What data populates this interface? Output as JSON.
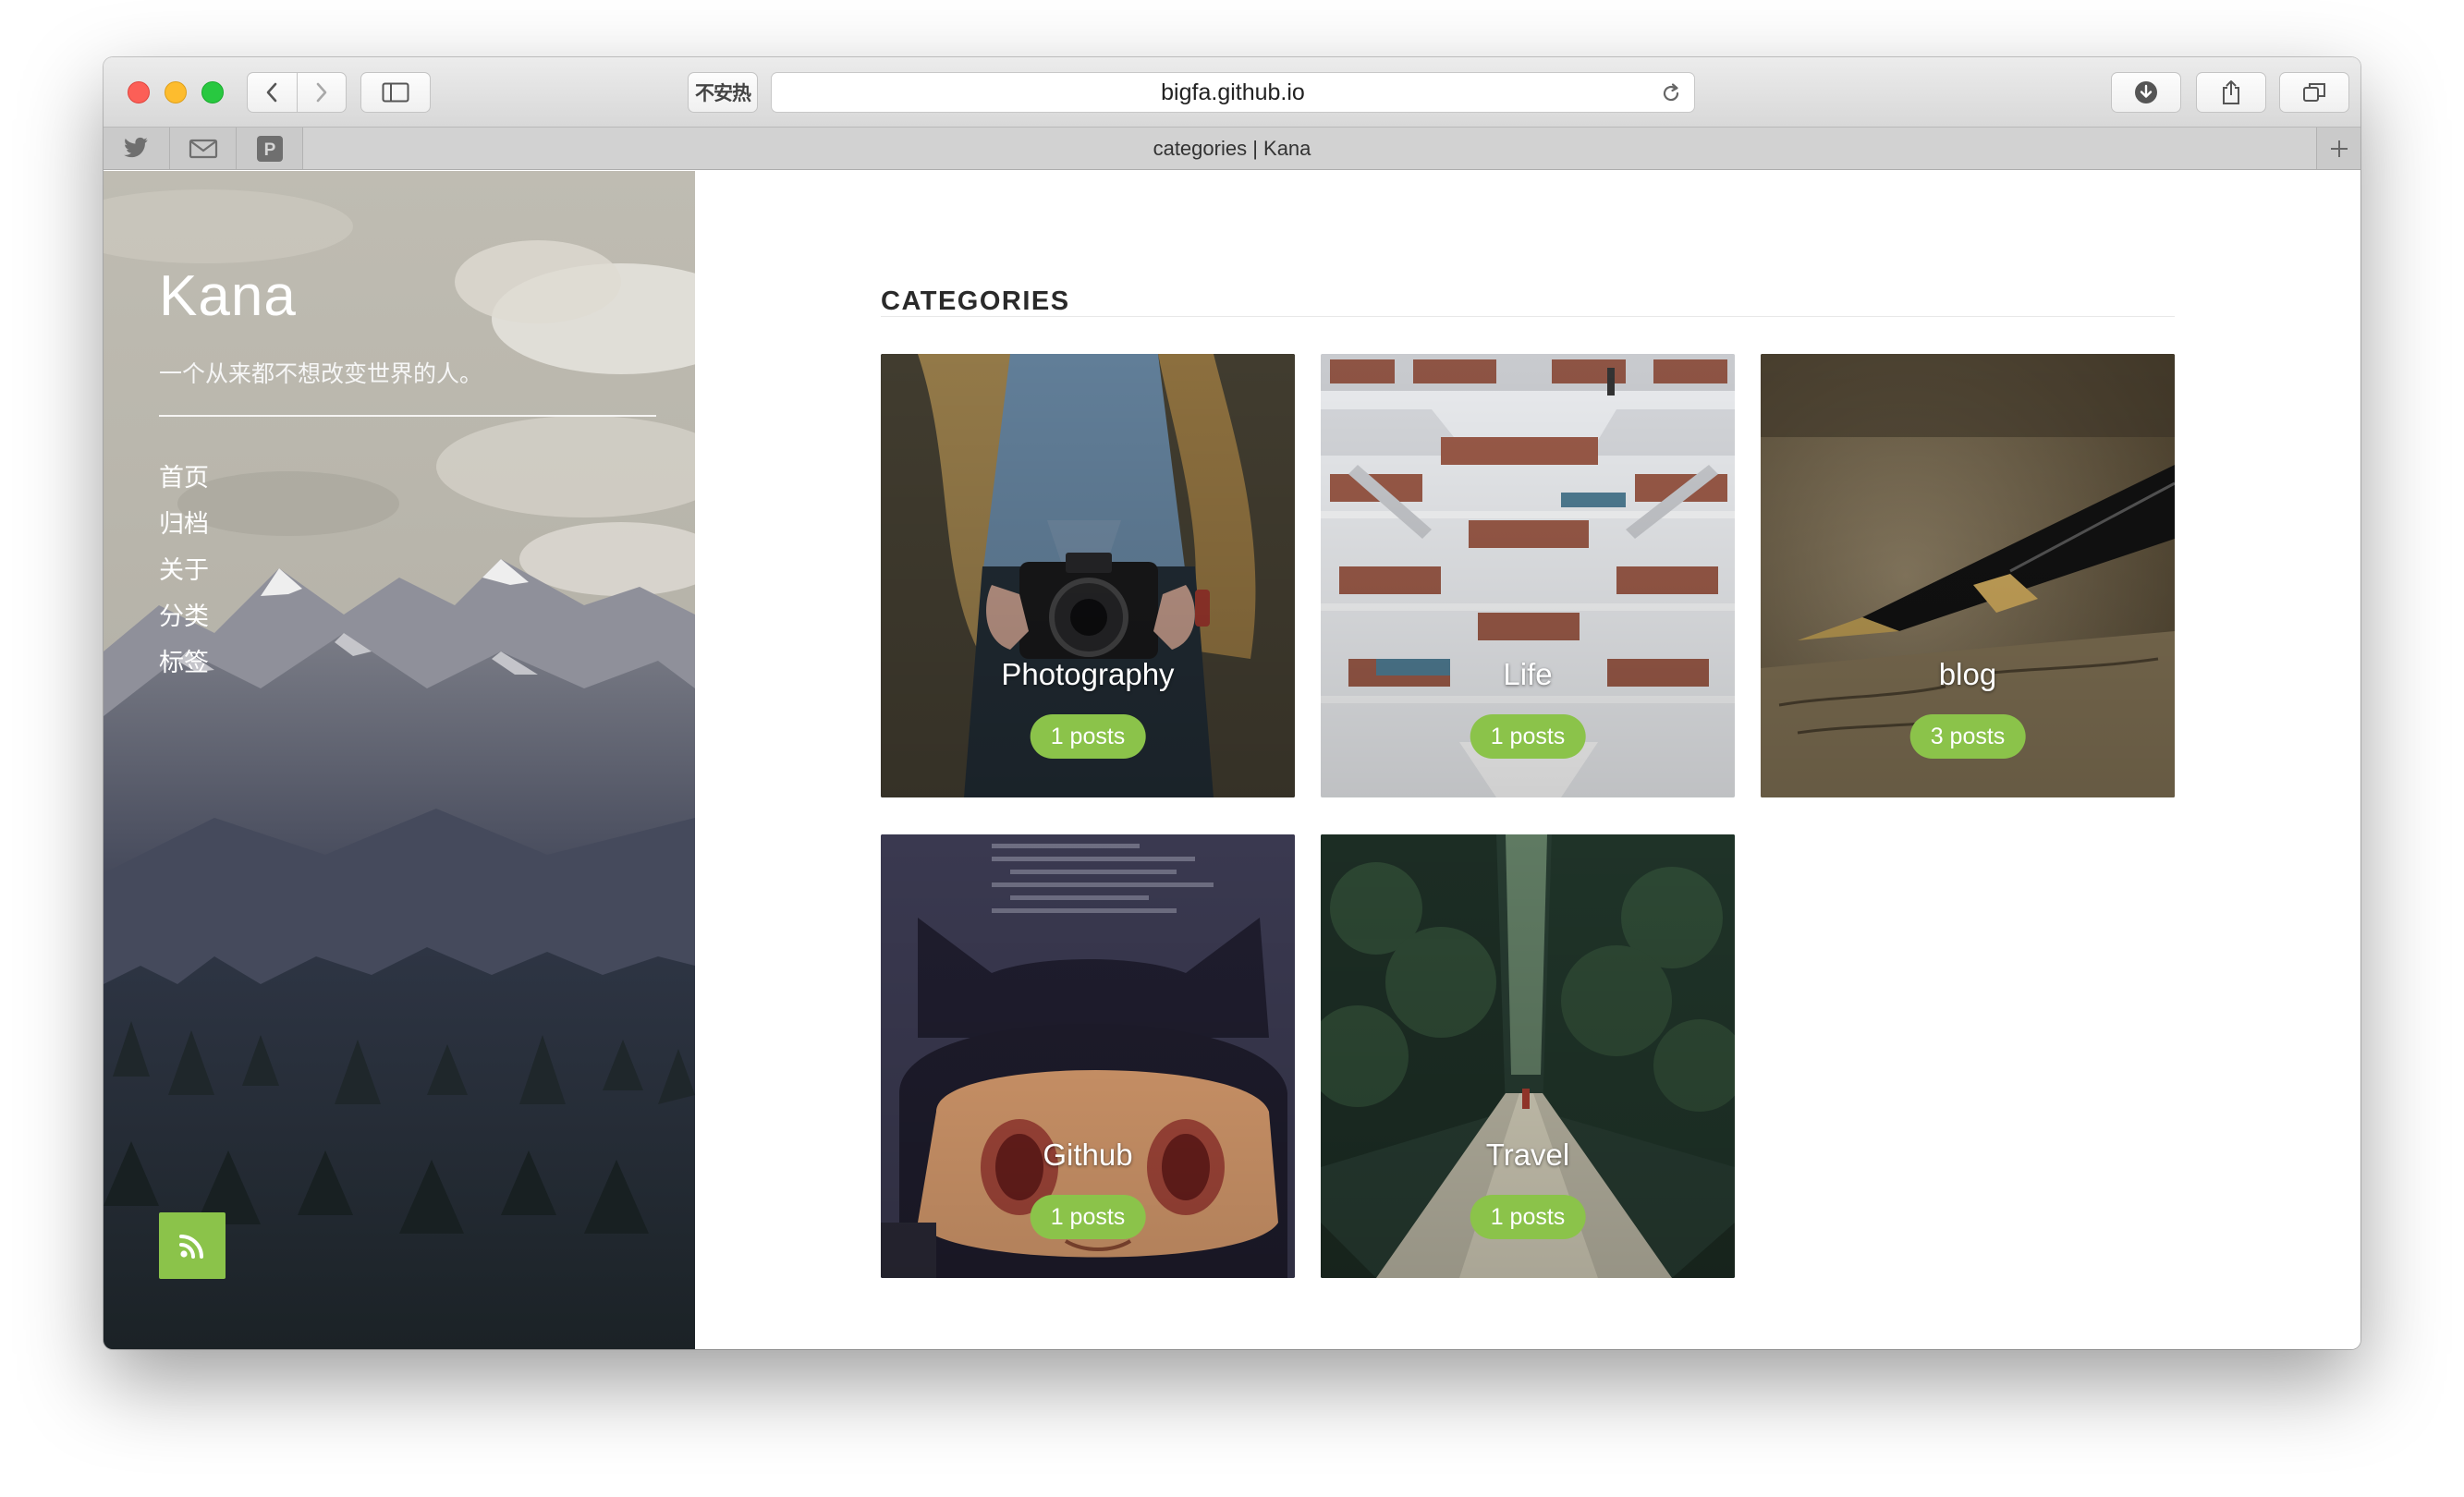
{
  "browser": {
    "url": "bigfa.github.io",
    "tab_title": "categories | Kana",
    "extension_label": "不安热",
    "bookmarks": [
      {
        "icon": "twitter-icon"
      },
      {
        "icon": "mail-icon"
      },
      {
        "icon": "pocket-icon",
        "label": "P"
      }
    ],
    "new_tab_label": "+"
  },
  "sidebar": {
    "title": "Kana",
    "tagline": "一个从来都不想改变世界的人。",
    "nav": [
      "首页",
      "归档",
      "关于",
      "分类",
      "标签"
    ],
    "rss_icon": "rss-icon"
  },
  "main": {
    "heading": "CATEGORIES",
    "categories": [
      {
        "name": "Photography",
        "count": "1 posts"
      },
      {
        "name": "Life",
        "count": "1 posts"
      },
      {
        "name": "blog",
        "count": "3 posts"
      },
      {
        "name": "Github",
        "count": "1 posts"
      },
      {
        "name": "Travel",
        "count": "1 posts"
      }
    ]
  },
  "colors": {
    "accent": "#8bc34a",
    "heading_text": "#2a2a2a",
    "close": "#fc5f57",
    "minimize": "#fdbc2e",
    "zoom": "#28c840"
  }
}
